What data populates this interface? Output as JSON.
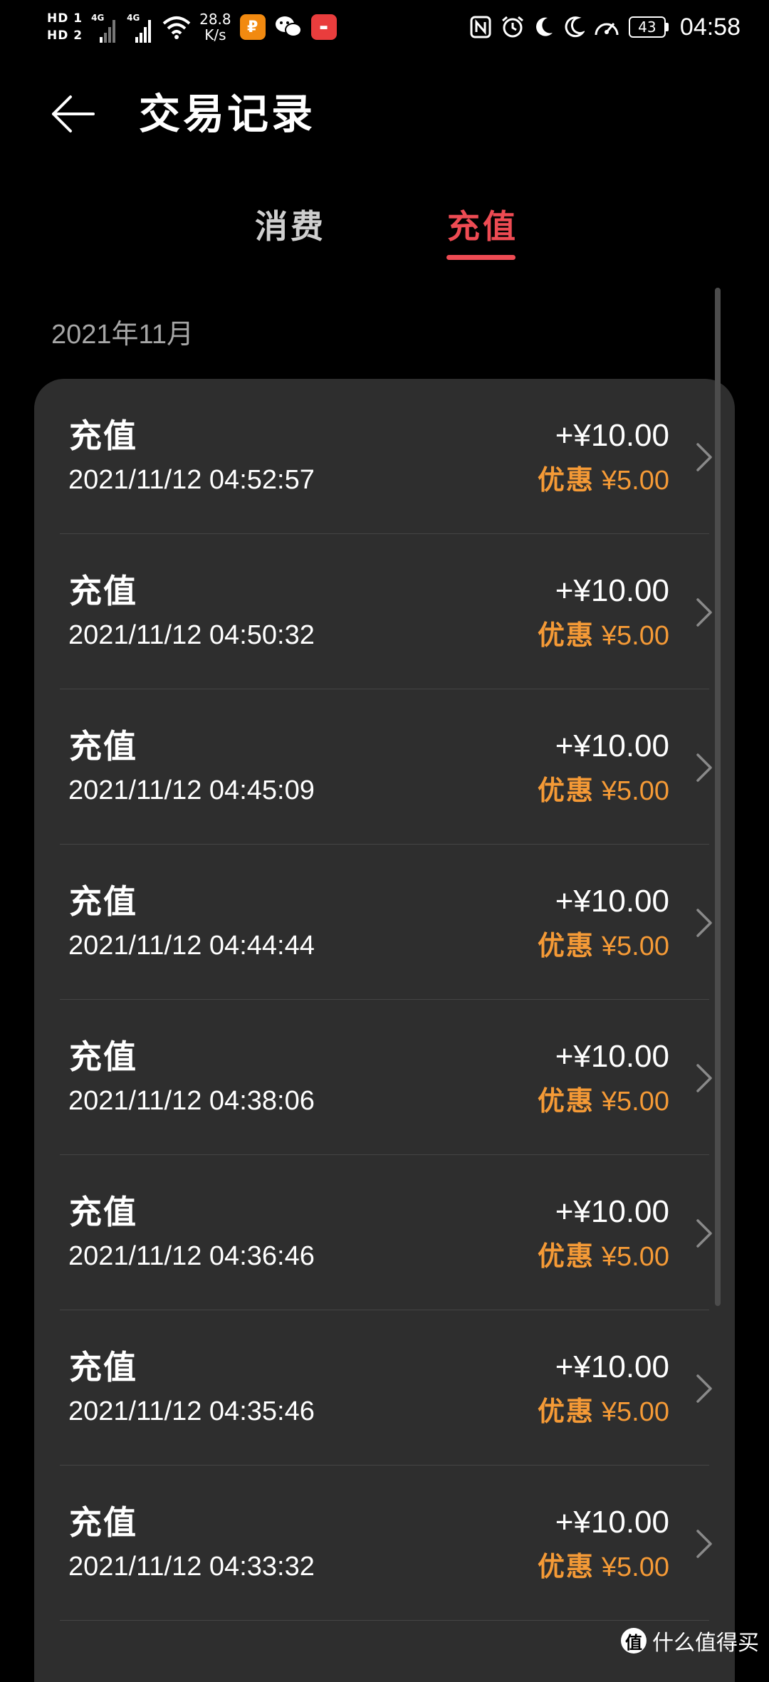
{
  "status_bar": {
    "sim1_label": "HD 1",
    "sim2_label": "HD 2",
    "net1": "4G",
    "net2": "4G",
    "speed_value": "28.8",
    "speed_unit": "K/s",
    "battery_level": "43",
    "time": "04:58",
    "icons": [
      "nfc-icon",
      "alarm-icon",
      "moon-icon",
      "moon-icon",
      "speedometer-icon"
    ]
  },
  "header": {
    "title": "交易记录",
    "back_icon": "arrow-left-icon"
  },
  "tabs": [
    {
      "label": "消费",
      "active": false
    },
    {
      "label": "充值",
      "active": true
    }
  ],
  "month": "2021年11月",
  "records": [
    {
      "type": "充值",
      "time": "2021/11/12 04:52:57",
      "amount": "+¥10.00",
      "discount_label": "优惠",
      "discount_amount": "¥5.00"
    },
    {
      "type": "充值",
      "time": "2021/11/12 04:50:32",
      "amount": "+¥10.00",
      "discount_label": "优惠",
      "discount_amount": "¥5.00"
    },
    {
      "type": "充值",
      "time": "2021/11/12 04:45:09",
      "amount": "+¥10.00",
      "discount_label": "优惠",
      "discount_amount": "¥5.00"
    },
    {
      "type": "充值",
      "time": "2021/11/12 04:44:44",
      "amount": "+¥10.00",
      "discount_label": "优惠",
      "discount_amount": "¥5.00"
    },
    {
      "type": "充值",
      "time": "2021/11/12 04:38:06",
      "amount": "+¥10.00",
      "discount_label": "优惠",
      "discount_amount": "¥5.00"
    },
    {
      "type": "充值",
      "time": "2021/11/12 04:36:46",
      "amount": "+¥10.00",
      "discount_label": "优惠",
      "discount_amount": "¥5.00"
    },
    {
      "type": "充值",
      "time": "2021/11/12 04:35:46",
      "amount": "+¥10.00",
      "discount_label": "优惠",
      "discount_amount": "¥5.00"
    },
    {
      "type": "充值",
      "time": "2021/11/12 04:33:32",
      "amount": "+¥10.00",
      "discount_label": "优惠",
      "discount_amount": "¥5.00"
    }
  ],
  "colors": {
    "background": "#000000",
    "card": "#2e2e2e",
    "accent_red": "#ee4b53",
    "discount_orange": "#f59a36",
    "month_gray": "#a6a6a6"
  },
  "watermark": {
    "logo_text": "值",
    "text": "什么值得买"
  }
}
